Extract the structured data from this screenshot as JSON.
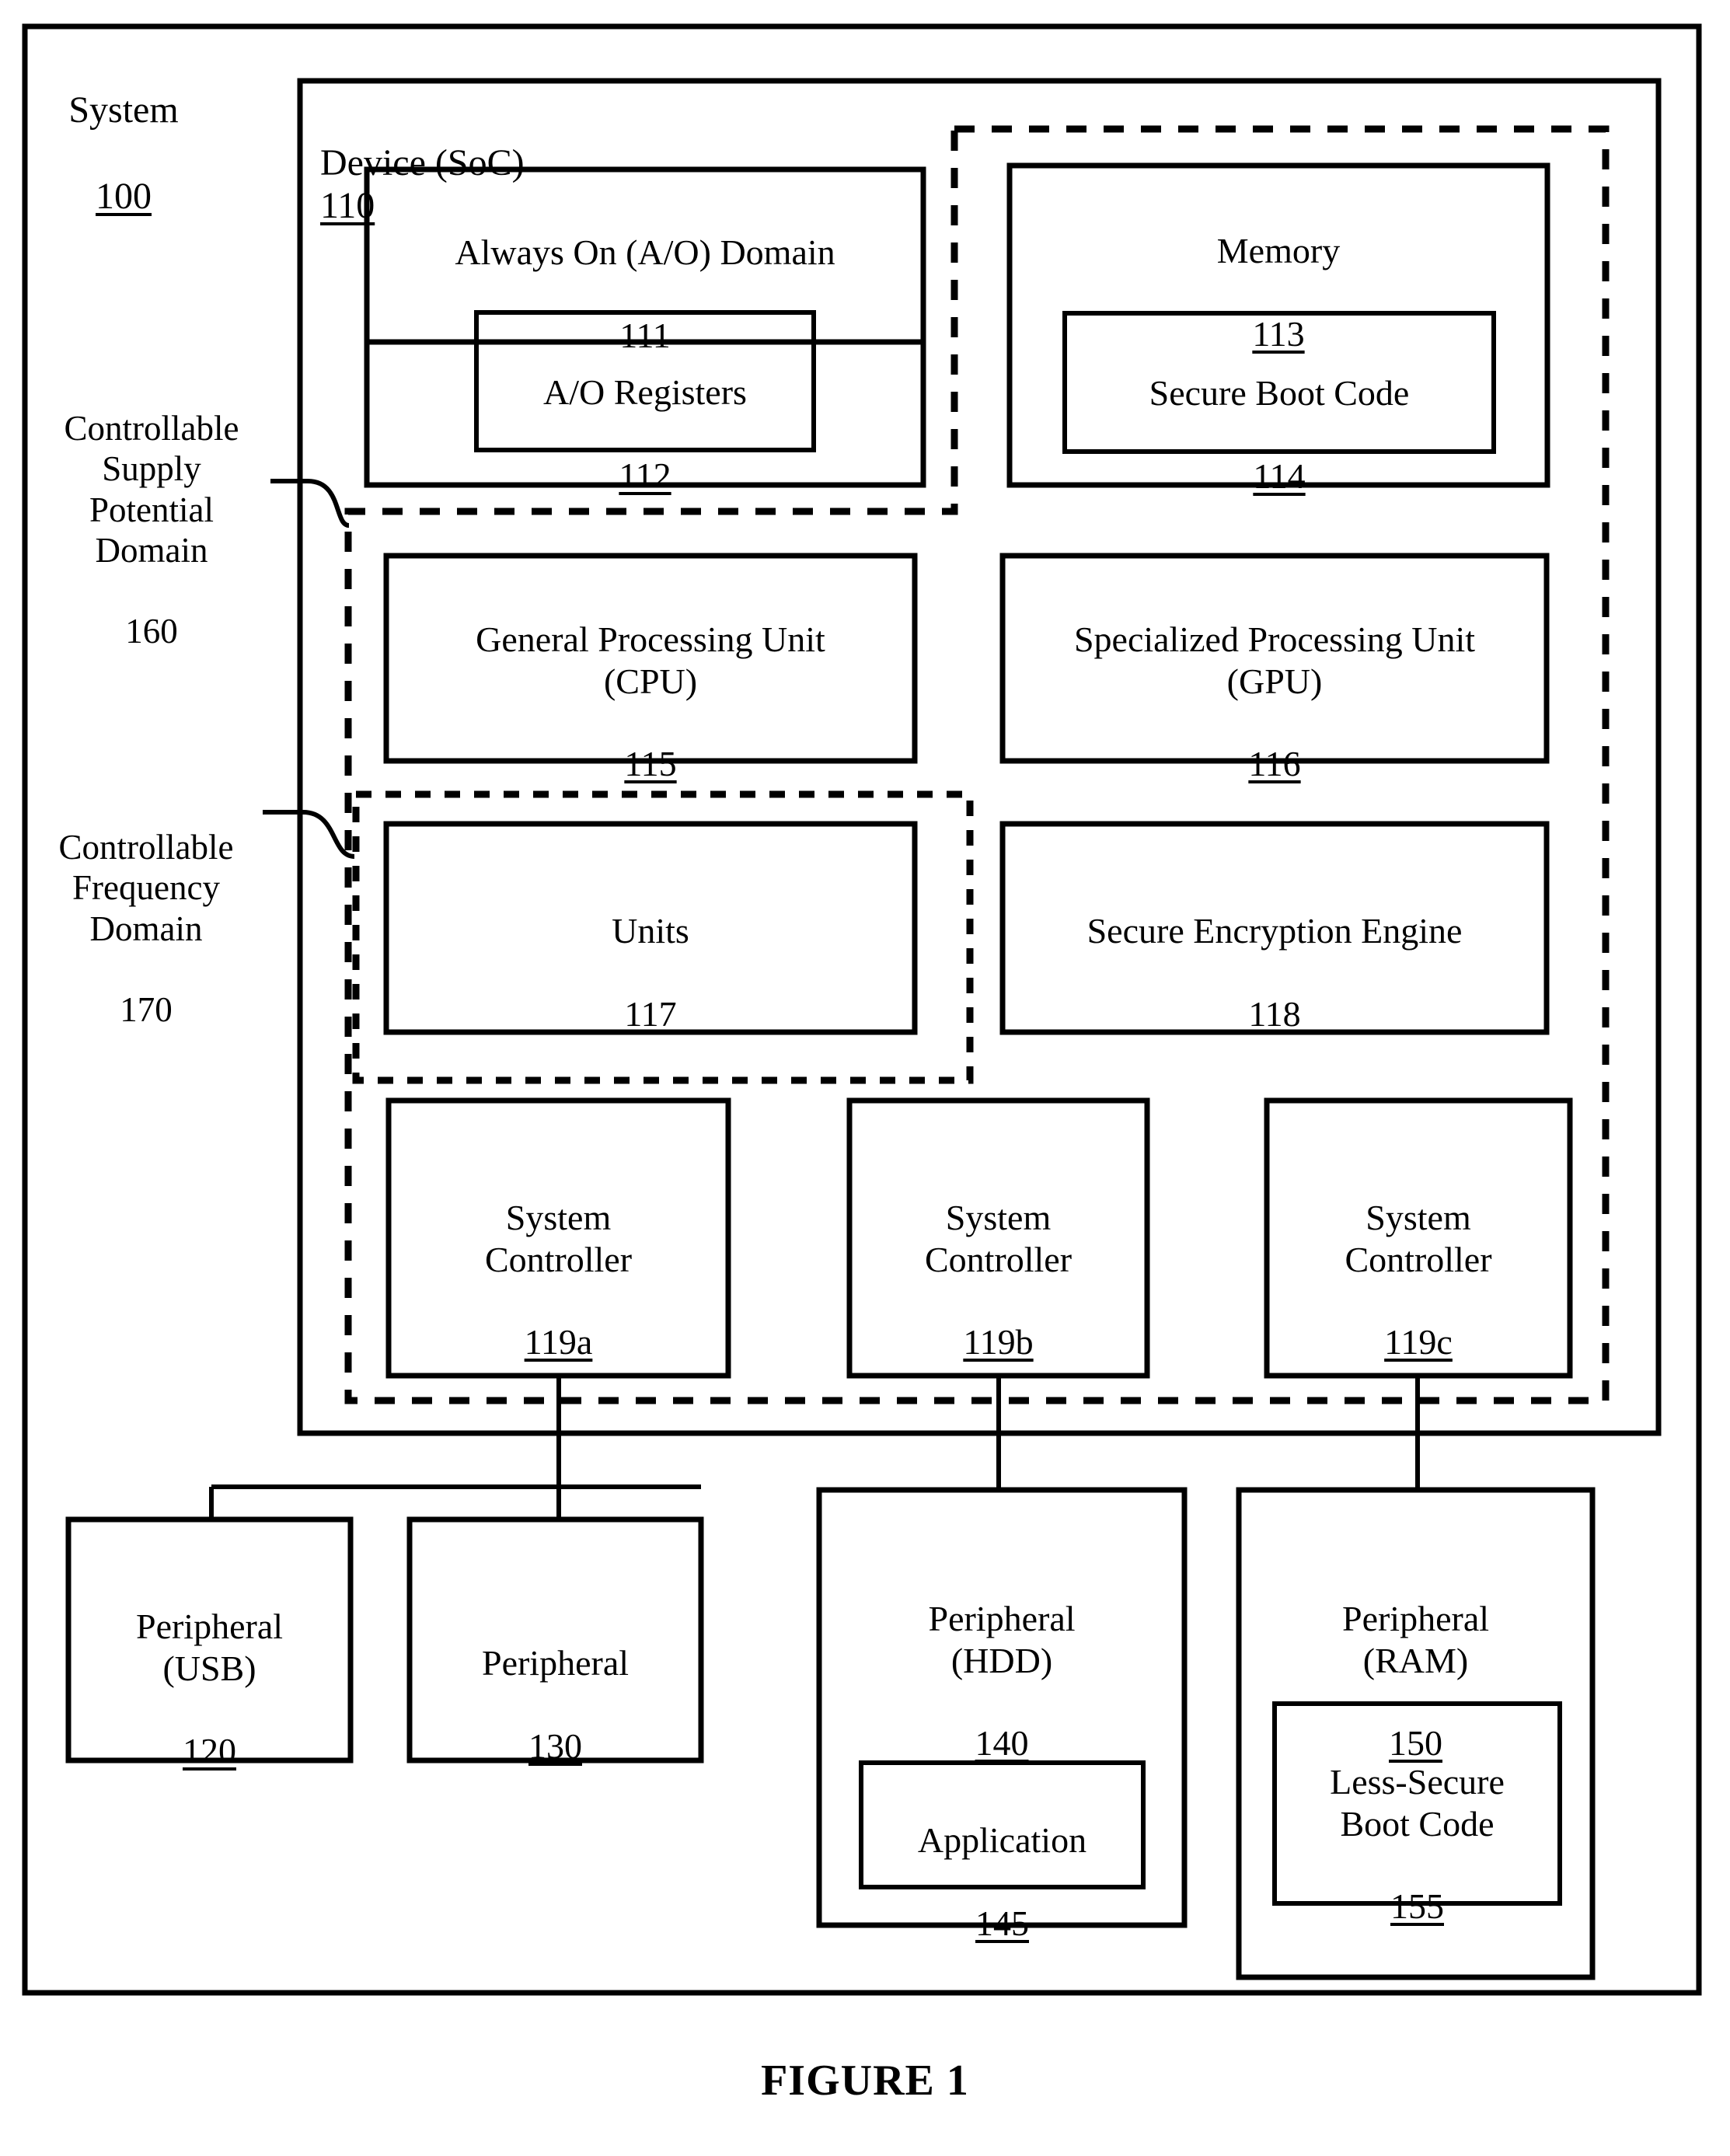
{
  "figure": {
    "caption": "FIGURE 1"
  },
  "system": {
    "label": "System",
    "ref": "100"
  },
  "device": {
    "label": "Device (SoC)",
    "ref": "110"
  },
  "domains": {
    "supply": {
      "label": "Controllable\nSupply\nPotential\nDomain",
      "ref": "160"
    },
    "frequency": {
      "label": "Controllable\nFrequency\nDomain",
      "ref": "170"
    }
  },
  "blocks": {
    "ao_domain": {
      "label": "Always On (A/O) Domain",
      "ref": "111",
      "ref_underline": false
    },
    "ao_registers": {
      "label": "A/O Registers",
      "ref": "112",
      "ref_underline": true
    },
    "memory": {
      "label": "Memory",
      "ref": "113",
      "ref_underline": true
    },
    "secure_boot_code": {
      "label": "Secure Boot Code",
      "ref": "114",
      "ref_underline": true
    },
    "cpu": {
      "label": "General Processing Unit\n(CPU)",
      "ref": "115",
      "ref_underline": true
    },
    "gpu": {
      "label": "Specialized Processing Unit\n(GPU)",
      "ref": "116",
      "ref_underline": true
    },
    "units": {
      "label": "Units",
      "ref": "117",
      "ref_underline": true
    },
    "secure_encryption_engine": {
      "label": "Secure Encryption Engine",
      "ref": "118",
      "ref_underline": true
    },
    "system_controller_a": {
      "label": "System\nController",
      "ref": "119a",
      "ref_underline": true
    },
    "system_controller_b": {
      "label": "System\nController",
      "ref": "119b",
      "ref_underline": true
    },
    "system_controller_c": {
      "label": "System\nController",
      "ref": "119c",
      "ref_underline": true
    },
    "peripheral_usb": {
      "label": "Peripheral\n(USB)",
      "ref": "120",
      "ref_underline": true
    },
    "peripheral_130": {
      "label": "Peripheral",
      "ref": "130",
      "ref_underline": true
    },
    "peripheral_hdd": {
      "label": "Peripheral\n(HDD)",
      "ref": "140",
      "ref_underline": true
    },
    "application": {
      "label": "Application",
      "ref": "145",
      "ref_underline": true
    },
    "peripheral_ram": {
      "label": "Peripheral\n(RAM)",
      "ref": "150",
      "ref_underline": true
    },
    "less_secure_boot_code": {
      "label": "Less-Secure\nBoot Code",
      "ref": "155",
      "ref_underline": true
    }
  },
  "colors": {
    "stroke": "#000000",
    "background": "#ffffff"
  }
}
